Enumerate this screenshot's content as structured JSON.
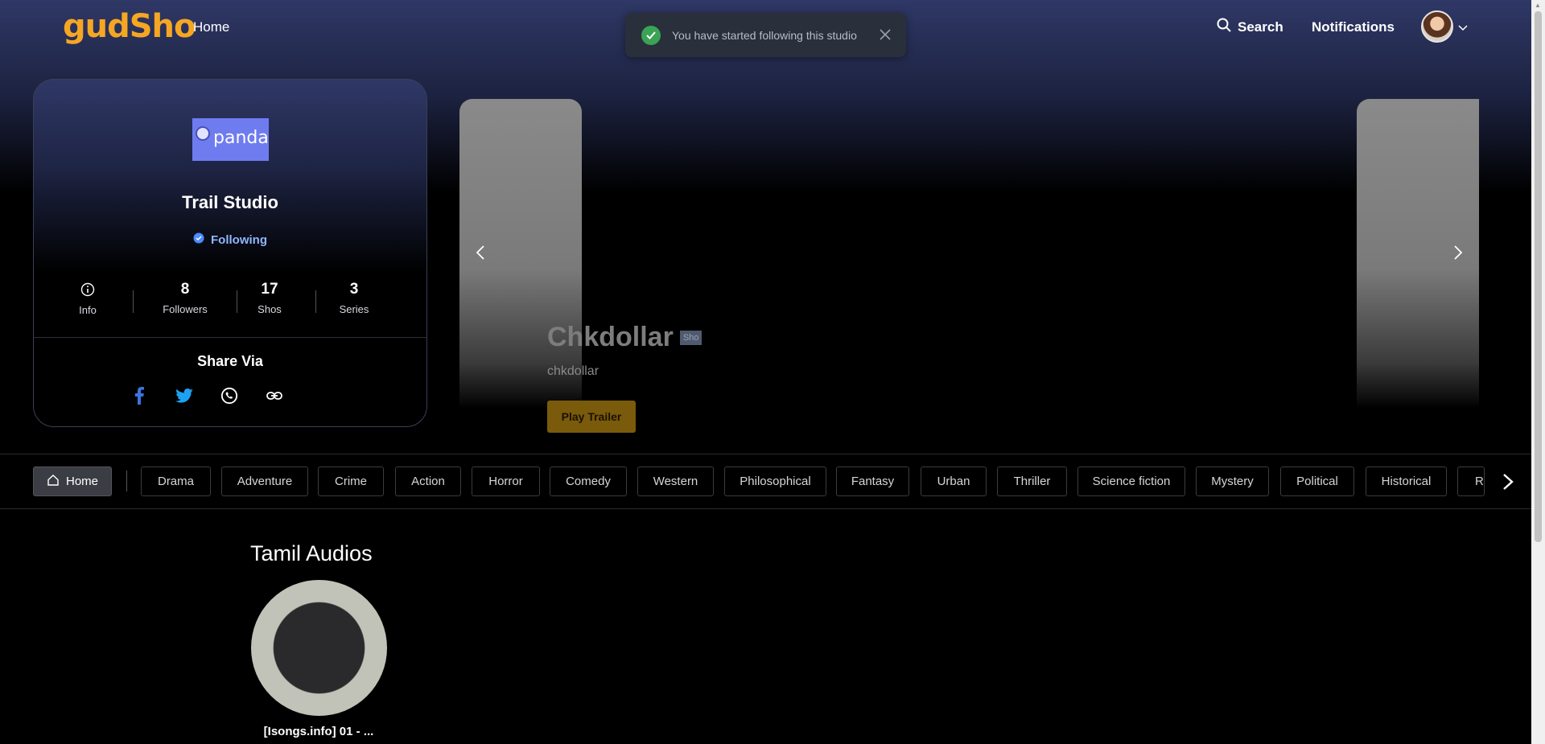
{
  "header": {
    "logo": "gudSho",
    "nav_home": "Home",
    "search_label": "Search",
    "notifications_label": "Notifications"
  },
  "toast": {
    "message": "You have started following this studio"
  },
  "studio": {
    "logo_text": "panda",
    "name": "Trail Studio",
    "follow_status": "Following",
    "stats": [
      {
        "value": "",
        "label": "Info"
      },
      {
        "value": "8",
        "label": "Followers"
      },
      {
        "value": "17",
        "label": "Shos"
      },
      {
        "value": "3",
        "label": "Series"
      }
    ],
    "share_title": "Share Via"
  },
  "hero": {
    "title": "Chkdollar",
    "badge": "Sho",
    "subtitle": "chkdollar",
    "play_trailer": "Play Trailer"
  },
  "genres": {
    "home": "Home",
    "items": [
      "Drama",
      "Adventure",
      "Crime",
      "Action",
      "Horror",
      "Comedy",
      "Western",
      "Philosophical",
      "Fantasy",
      "Urban",
      "Thriller",
      "Science fiction",
      "Mystery",
      "Political",
      "Historical",
      "Ro"
    ]
  },
  "section": {
    "title": "Tamil Audios",
    "items": [
      {
        "label": "[Isongs.info] 01 - ..."
      }
    ]
  },
  "colors": {
    "brand": "#f5a623",
    "following": "#8fb7ff",
    "toast_check": "#3aa356",
    "play_trailer": "#7a5a0b"
  }
}
